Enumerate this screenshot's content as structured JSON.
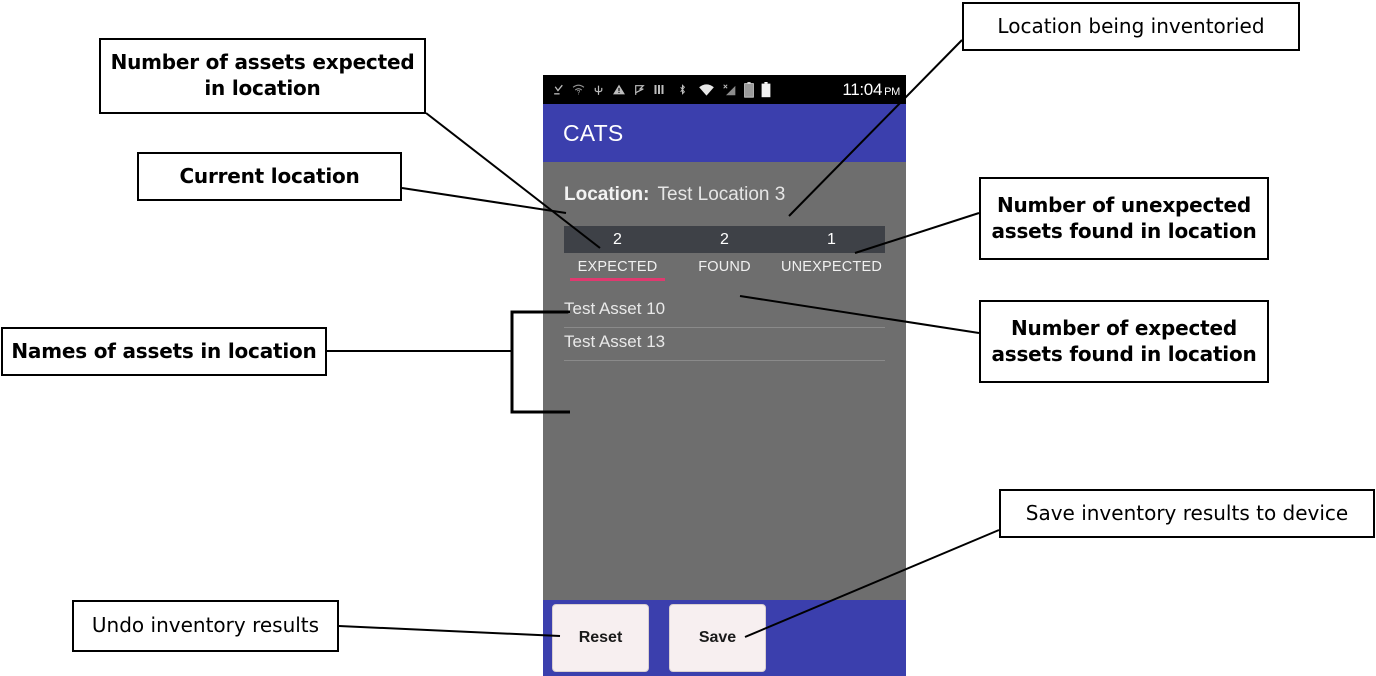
{
  "app": {
    "statusbar": {
      "icons": [
        "download-complete-icon",
        "unknown-network-icon",
        "usb-icon",
        "warning-icon",
        "flag-icon",
        "sim-bars-icon",
        "bluetooth-icon",
        "wifi-icon",
        "cellular-signal-icon",
        "battery-charging-icon",
        "battery-full-icon"
      ],
      "time": "11:04",
      "ampm": "PM"
    },
    "appbar": {
      "title": "CATS"
    },
    "location": {
      "label": "Location:",
      "value": "Test Location 3"
    },
    "counts": [
      "2",
      "2",
      "1"
    ],
    "tabs": [
      {
        "label": "EXPECTED",
        "active": true
      },
      {
        "label": "FOUND",
        "active": false
      },
      {
        "label": "UNEXPECTED",
        "active": false
      }
    ],
    "assets": [
      "Test Asset 10",
      "Test Asset 13"
    ],
    "buttons": {
      "reset": "Reset",
      "save": "Save"
    },
    "colors": {
      "appbar_blue": "#3b3fad",
      "screen_gray": "#6e6e6e",
      "counts_bar": "#3e4147",
      "tab_indicator": "#e0396f",
      "button_face": "#f7eff0",
      "statusbar_black": "#000000"
    }
  },
  "annotations": [
    {
      "id": "assets-expected",
      "text": "Number of assets expected in location",
      "style": "bold"
    },
    {
      "id": "current-location",
      "text": "Current location",
      "style": "bold"
    },
    {
      "id": "asset-names",
      "text": "Names of assets in location",
      "style": "bold"
    },
    {
      "id": "undo-results",
      "text": "Undo inventory results",
      "style": "light"
    },
    {
      "id": "location-inventoried",
      "text": "Location being inventoried",
      "style": "light"
    },
    {
      "id": "unexpected-found",
      "text": "Number of unexpected assets found in location",
      "style": "bold"
    },
    {
      "id": "expected-found",
      "text": "Number of expected assets found in location",
      "style": "bold"
    },
    {
      "id": "save-results",
      "text": "Save inventory results to device",
      "style": "light"
    }
  ]
}
